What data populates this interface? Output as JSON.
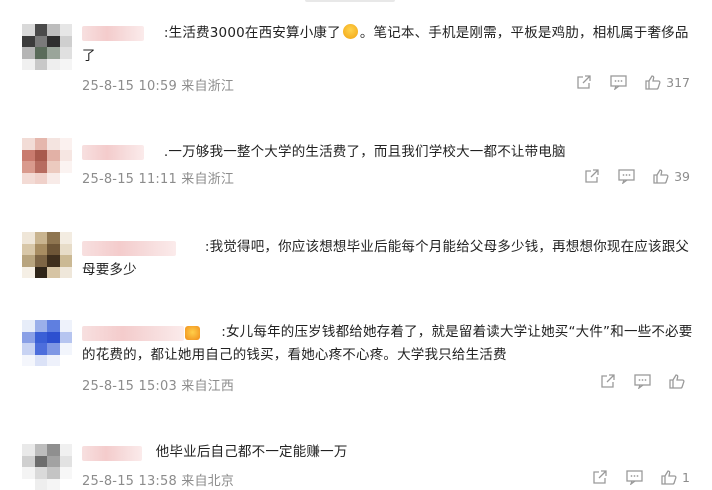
{
  "comments": [
    {
      "text": ":生活费3000在西安算小康了",
      "text_after_emoji": "。笔记本、手机是刚需，平板是鸡肋，相机属于奢侈品了",
      "date": "25-8-15 10:59",
      "location": "来自浙江",
      "likes": "317"
    },
    {
      "text": ".一万够我一整个大学的生活费了，而且我们学校大一都不让带电脑",
      "date": "25-8-15 11:11",
      "location": "来自浙江",
      "likes": "39"
    },
    {
      "text": ":我觉得吧，你应该想想毕业后能每个月能给父母多少钱，再想想你现在应该跟父母要多少",
      "date": "",
      "location": "",
      "likes": ""
    },
    {
      "text": ":女儿每年的压岁钱都给她存着了，就是留着读大学让她买“大件”和一些不必要的花费的，都让她用自己的钱买，看她心疼不心疼。大学我只给生活费",
      "date": "25-8-15 15:03",
      "location": "来自江西",
      "likes": ""
    },
    {
      "text": "他毕业后自己都不一定能赚一万",
      "date": "25-8-15 13:58",
      "location": "来自北京",
      "likes": "1"
    }
  ],
  "icons": {
    "share": "share-icon",
    "comment": "comment-icon",
    "like": "thumbs-up-icon"
  }
}
